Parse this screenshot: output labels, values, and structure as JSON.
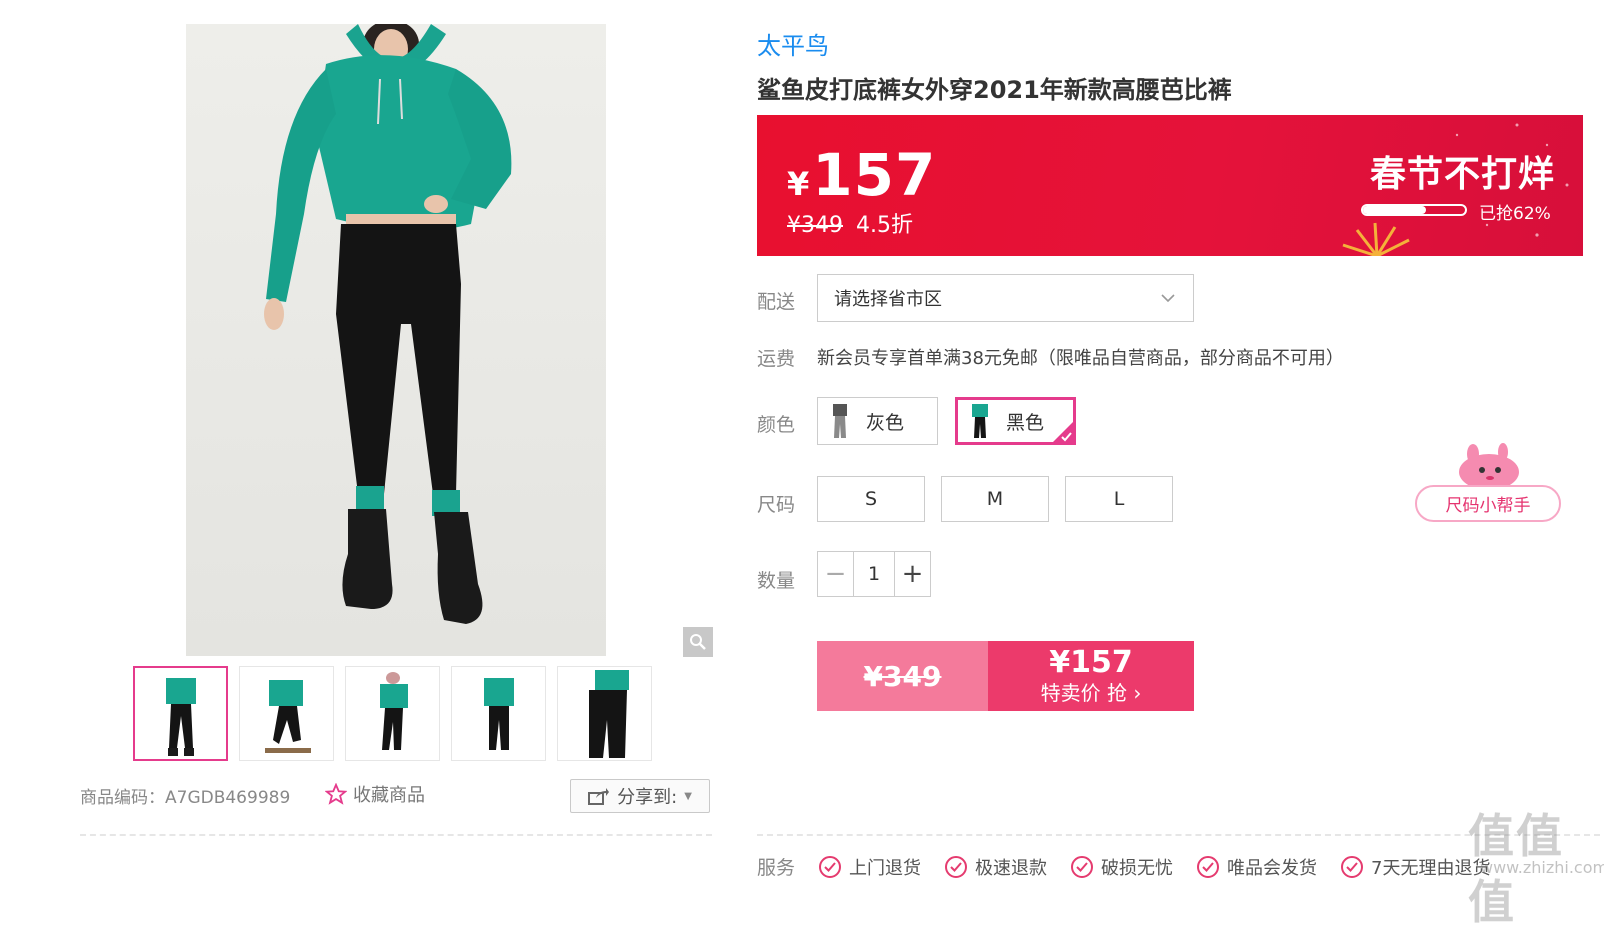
{
  "product": {
    "brand": "太平鸟",
    "title": "鲨鱼皮打底裤女外穿2021年新款高腰芭比裤"
  },
  "price": {
    "currency": "¥",
    "current": "157",
    "original": "¥349",
    "discount": "4.5折",
    "promo_title": "春节不打烊",
    "sold_label": "已抢62%",
    "sold_percent": 0.62
  },
  "delivery": {
    "label": "配送",
    "placeholder": "请选择省市区"
  },
  "shipping": {
    "label": "运费",
    "text": "新会员专享首单满38元免邮（限唯品自营商品，部分商品不可用）"
  },
  "color": {
    "label": "颜色",
    "options": [
      {
        "label": "灰色",
        "selected": false
      },
      {
        "label": "黑色",
        "selected": true
      }
    ]
  },
  "size": {
    "label": "尺码",
    "options": [
      "S",
      "M",
      "L"
    ],
    "helper": "尺码小帮手"
  },
  "quantity": {
    "label": "数量",
    "value": "1",
    "minus": "−",
    "plus": "+"
  },
  "buy": {
    "original": "¥349",
    "price": "¥157",
    "label": "特卖价 抢 ›"
  },
  "gallery": {
    "thumb_count": 5,
    "active_index": 0
  },
  "meta": {
    "sku": "商品编码：A7GDB469989",
    "favorite": "收藏商品",
    "share": "分享到:"
  },
  "services": {
    "label": "服务",
    "items": [
      "上门退货",
      "极速退款",
      "破损无忧",
      "唯品会发货",
      "7天无理由退货"
    ]
  },
  "watermark": {
    "main": "值值值",
    "sub": "www.zhizhi.com"
  },
  "colors": {
    "accent": "#e53b8c",
    "brand": "#1a8cef",
    "banner": "#e8102f"
  }
}
